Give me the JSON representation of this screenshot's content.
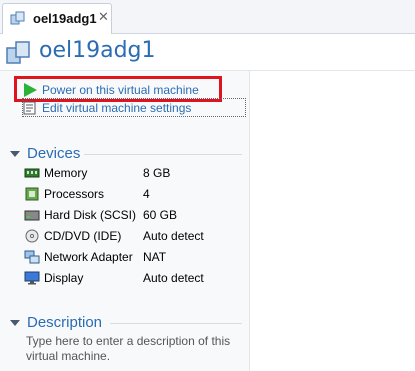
{
  "tab": {
    "title": "oel19adg1",
    "close_glyph": "✕",
    "icon": "vm-icon"
  },
  "vm": {
    "title": "oel19adg1",
    "icon": "vm-icon"
  },
  "actions": {
    "power_on": "Power on this virtual machine",
    "edit_settings": "Edit virtual machine settings"
  },
  "devices": {
    "title": "Devices",
    "items": [
      {
        "name": "Memory",
        "value": "8 GB",
        "icon": "memory-icon"
      },
      {
        "name": "Processors",
        "value": "4",
        "icon": "processor-icon"
      },
      {
        "name": "Hard Disk (SCSI)",
        "value": "60 GB",
        "icon": "hard-disk-icon"
      },
      {
        "name": "CD/DVD (IDE)",
        "value": "Auto detect",
        "icon": "cd-dvd-icon"
      },
      {
        "name": "Network Adapter",
        "value": "NAT",
        "icon": "network-adapter-icon"
      },
      {
        "name": "Display",
        "value": "Auto detect",
        "icon": "display-icon"
      }
    ]
  },
  "description": {
    "title": "Description",
    "placeholder": "Type here to enter a description of this virtual machine."
  },
  "colors": {
    "accent": "#2b6cb3",
    "highlight": "#e0141e",
    "play": "#2bb23a"
  }
}
